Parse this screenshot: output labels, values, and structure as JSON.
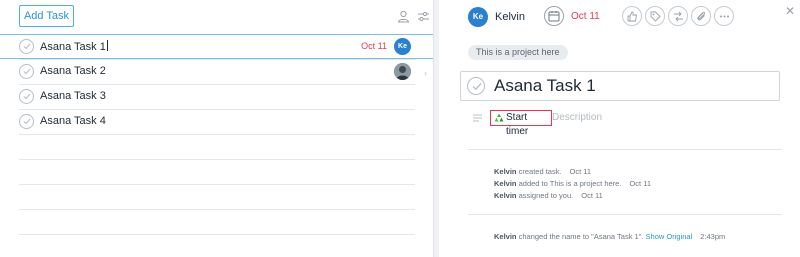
{
  "left": {
    "add_task_label": "Add Task",
    "tasks": [
      {
        "name": "Asana Task 1",
        "due": "Oct 11",
        "assignee_initials": "Ke",
        "selected": true
      },
      {
        "name": "Asana Task 2",
        "due": "",
        "assignee_initials": "",
        "selected": false
      },
      {
        "name": "Asana Task 3",
        "due": "",
        "assignee_initials": "",
        "selected": false
      },
      {
        "name": "Asana Task 4",
        "due": "",
        "assignee_initials": "",
        "selected": false
      }
    ]
  },
  "right": {
    "assignee": {
      "initials": "Ke",
      "name": "Kelvin"
    },
    "due_date": "Oct 11",
    "project_pill": "This is a project here",
    "task_title": "Asana Task 1",
    "timer_label": "Start timer",
    "description_placeholder": "Description",
    "stories": [
      {
        "actor": "Kelvin",
        "text": " created task.",
        "time": "Oct 11"
      },
      {
        "actor": "Kelvin",
        "text": " added to This is a project here.",
        "time": "Oct 11"
      },
      {
        "actor": "Kelvin",
        "text": " assigned to you.",
        "time": "Oct 11"
      }
    ],
    "rename_story": {
      "actor": "Kelvin",
      "text": " changed the name to \"Asana Task 1\". ",
      "link": "Show Original",
      "time": "2:43pm"
    }
  },
  "colors": {
    "accent": "#2a93d5",
    "due_red": "#e8384f",
    "selection_border": "#74c0ea",
    "avatar_blue": "#2a7fcf"
  },
  "icons": [
    "person-icon",
    "filter-icon",
    "check-icon",
    "calendar-icon",
    "like-icon",
    "tag-icon",
    "subtask-icon",
    "attachment-icon",
    "more-icon",
    "close-icon",
    "description-icon",
    "harvest-logo-icon",
    "chevron-right-icon"
  ]
}
